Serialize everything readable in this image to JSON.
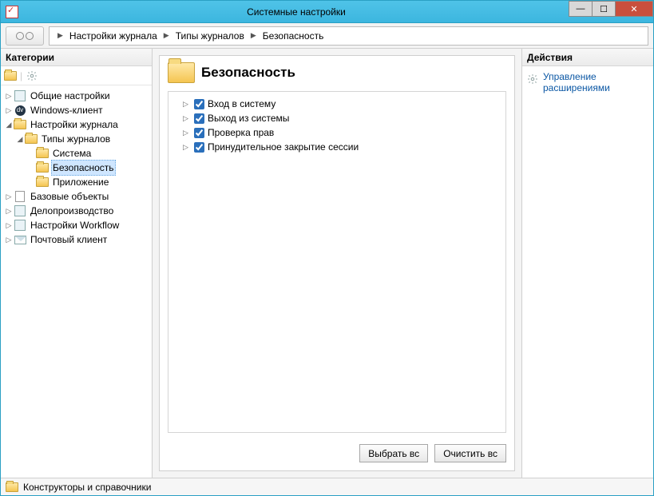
{
  "window": {
    "title": "Системные настройки"
  },
  "breadcrumb": {
    "items": [
      "Настройки журнала",
      "Типы журналов",
      "Безопасность"
    ]
  },
  "left": {
    "header": "Категории",
    "tree": [
      {
        "depth": 0,
        "expander": "▷",
        "icon": "square",
        "label": "Общие настройки"
      },
      {
        "depth": 0,
        "expander": "▷",
        "icon": "circle",
        "label": "Windows-клиент"
      },
      {
        "depth": 0,
        "expander": "◢",
        "icon": "folder",
        "label": "Настройки журнала"
      },
      {
        "depth": 1,
        "expander": "◢",
        "icon": "folder",
        "label": "Типы журналов"
      },
      {
        "depth": 2,
        "expander": "",
        "icon": "folder",
        "label": "Система"
      },
      {
        "depth": 2,
        "expander": "",
        "icon": "folder",
        "label": "Безопасность",
        "selected": true
      },
      {
        "depth": 2,
        "expander": "",
        "icon": "folder",
        "label": "Приложение"
      },
      {
        "depth": 0,
        "expander": "▷",
        "icon": "doc",
        "label": "Базовые объекты"
      },
      {
        "depth": 0,
        "expander": "▷",
        "icon": "square",
        "label": "Делопроизводство"
      },
      {
        "depth": 0,
        "expander": "▷",
        "icon": "square",
        "label": "Настройки Workflow"
      },
      {
        "depth": 0,
        "expander": "▷",
        "icon": "mail",
        "label": "Почтовый клиент"
      }
    ]
  },
  "center": {
    "title": "Безопасность",
    "events": [
      {
        "label": "Вход в систему",
        "checked": true
      },
      {
        "label": "Выход из системы",
        "checked": true
      },
      {
        "label": "Проверка прав",
        "checked": true
      },
      {
        "label": "Принудительное закрытие сессии",
        "checked": true
      }
    ],
    "buttons": {
      "select_all": "Выбрать вс",
      "clear_all": "Очистить вс"
    }
  },
  "right": {
    "header": "Действия",
    "action_link": "Управление расширениями"
  },
  "status": {
    "text": "Конструкторы и справочники"
  }
}
